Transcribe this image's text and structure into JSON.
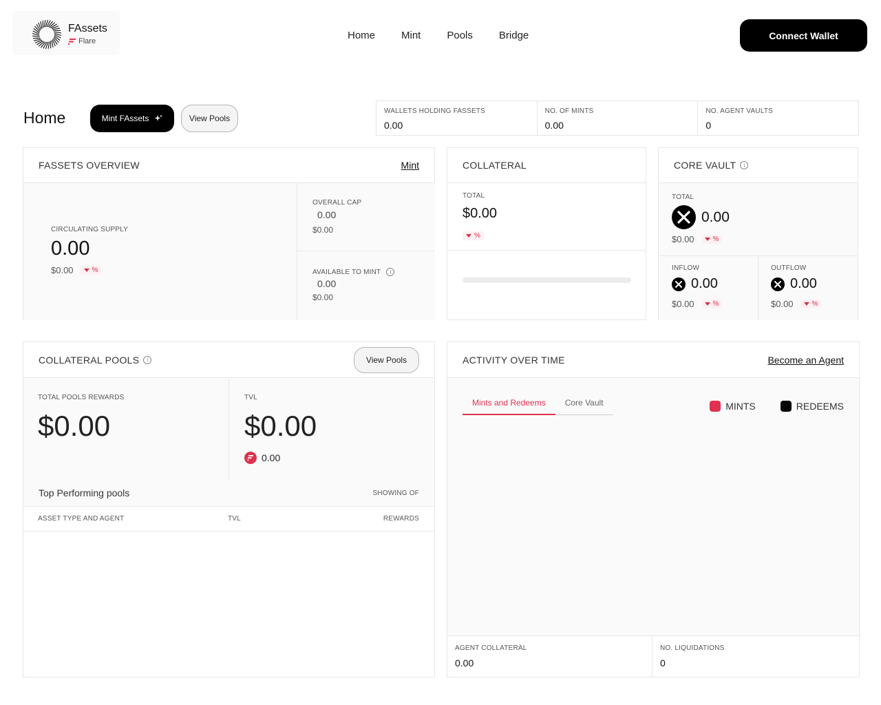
{
  "header": {
    "brand_title": "FAssets",
    "brand_sub": "Flare",
    "nav": [
      "Home",
      "Mint",
      "Pools",
      "Bridge"
    ],
    "connect_label": "Connect Wallet"
  },
  "page": {
    "title": "Home",
    "mint_button": "Mint FAssets",
    "view_pools_button": "View Pools"
  },
  "stats": [
    {
      "label": "WALLETS HOLDING FASSETS",
      "value": "0.00"
    },
    {
      "label": "NO. OF MINTS",
      "value": "0.00"
    },
    {
      "label": "NO. AGENT VAULTS",
      "value": "0"
    }
  ],
  "overview": {
    "title": "FASSETS OVERVIEW",
    "link": "Mint",
    "circ_label": "CIRCULATING SUPPLY",
    "circ_value": "0.00",
    "circ_usd": "$0.00",
    "pct": "%",
    "cap_label": "OVERALL CAP",
    "cap_value": "0.00",
    "cap_usd": "$0.00",
    "avail_label": "AVAILABLE TO MINT",
    "avail_value": "0.00",
    "avail_usd": "$0.00"
  },
  "collateral": {
    "title": "COLLATERAL",
    "total_label": "TOTAL",
    "total_value": "$0.00",
    "pct": "%",
    "progress": 0
  },
  "core_vault": {
    "title": "CORE VAULT",
    "total_label": "TOTAL",
    "total_value": "0.00",
    "total_usd": "$0.00",
    "inflow_label": "INFLOW",
    "inflow_value": "0.00",
    "inflow_usd": "$0.00",
    "outflow_label": "OUTFLOW",
    "outflow_value": "0.00",
    "outflow_usd": "$0.00",
    "pct": "%"
  },
  "pools": {
    "title": "COLLATERAL POOLS",
    "view_button": "View Pools",
    "rewards_label": "TOTAL POOLS REWARDS",
    "rewards_value": "$0.00",
    "tvl_label": "TVL",
    "tvl_value": "$0.00",
    "flr_value": "0.00",
    "top_label": "Top Performing pools",
    "showing_label": "SHOWING OF",
    "col_asset": "ASSET TYPE AND AGENT",
    "col_tvl": "TVL",
    "col_rewards": "REWARDS"
  },
  "activity": {
    "title": "ACTIVITY OVER TIME",
    "link": "Become an Agent",
    "tabs": [
      "Mints and Redeems",
      "Core Vault"
    ],
    "legend": [
      {
        "label": "MINTS",
        "color": "#e0314e"
      },
      {
        "label": "REDEEMS",
        "color": "#000000"
      }
    ],
    "agent_collateral_label": "AGENT COLLATERAL",
    "agent_collateral_value": "0.00",
    "liquidations_label": "NO. LIQUIDATIONS",
    "liquidations_value": "0"
  },
  "colors": {
    "accent": "#e0314e",
    "primary": "#000000"
  }
}
